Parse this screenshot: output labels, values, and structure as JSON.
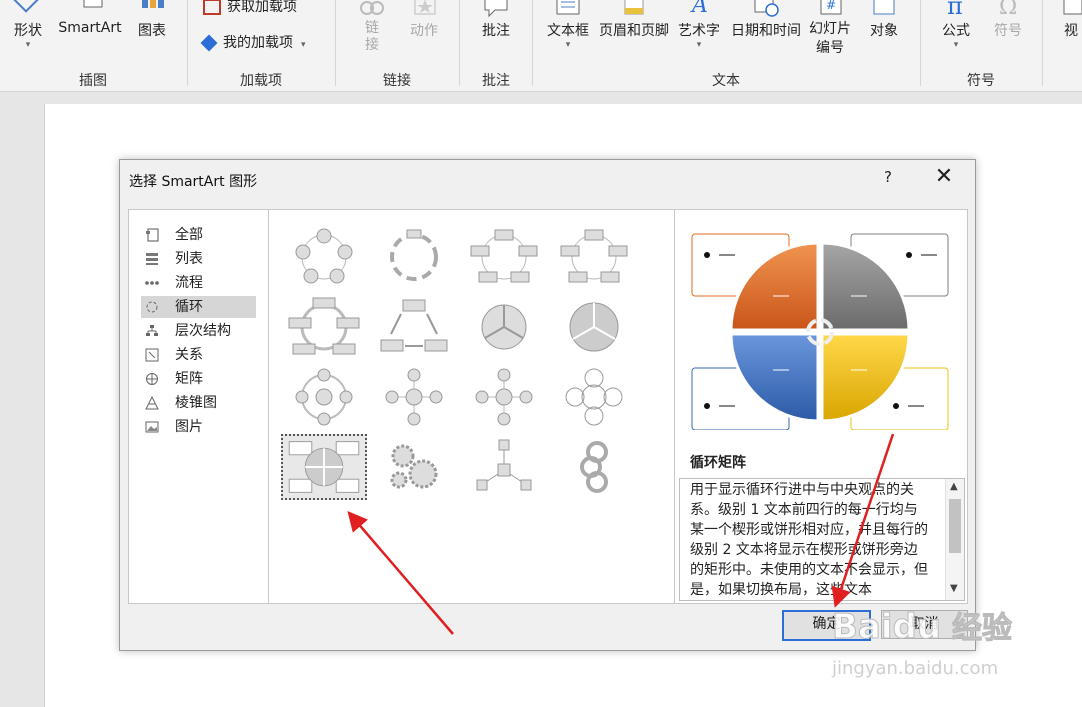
{
  "ribbon": {
    "shapes_label": "形状",
    "smartart_label": "SmartArt",
    "chart_label": "图表",
    "illustrations_group": "插图",
    "get_addins_label": "获取加载项",
    "my_addins_label": "我的加载项",
    "addins_group": "加载项",
    "link_label": "链接",
    "action_label": "动作",
    "links_group": "链接",
    "comment_label": "批注",
    "comments_group": "批注",
    "textbox_label": "文本框",
    "header_footer_label": "页眉和页脚",
    "wordart_label": "艺术字",
    "datetime_label": "日期和时间",
    "slide_number_label": "幻灯片编号",
    "object_label": "对象",
    "text_group": "文本",
    "equation_label": "公式",
    "symbol_label": "符号",
    "symbols_group": "符号",
    "view_label": "视"
  },
  "dialog": {
    "title": "选择 SmartArt 图形",
    "help": "?",
    "close": "✕",
    "categories": [
      {
        "label": "全部"
      },
      {
        "label": "列表"
      },
      {
        "label": "流程"
      },
      {
        "label": "循环",
        "selected": true
      },
      {
        "label": "层次结构"
      },
      {
        "label": "关系"
      },
      {
        "label": "矩阵"
      },
      {
        "label": "棱锥图"
      },
      {
        "label": "图片"
      }
    ],
    "preview": {
      "name": "循环矩阵",
      "description": "用于显示循环行进中与中央观点的关系。级别 1 文本前四行的每一行均与某一个楔形或饼形相对应，并且每行的级别 2 文本将显示在楔形或饼形旁边的矩形中。未使用的文本不会显示，但是，如果切换布局，这些文本",
      "colors": {
        "orange": "#e26b1f",
        "gray": "#7f7f7f",
        "blue": "#3a67b3",
        "yellow": "#f2c010"
      }
    },
    "ok_label": "确定",
    "cancel_label": "取消"
  },
  "watermark": {
    "brand": "Baidu",
    "cn": "经验",
    "url": "jingyan.baidu.com"
  },
  "annotation_color": "#e02020"
}
